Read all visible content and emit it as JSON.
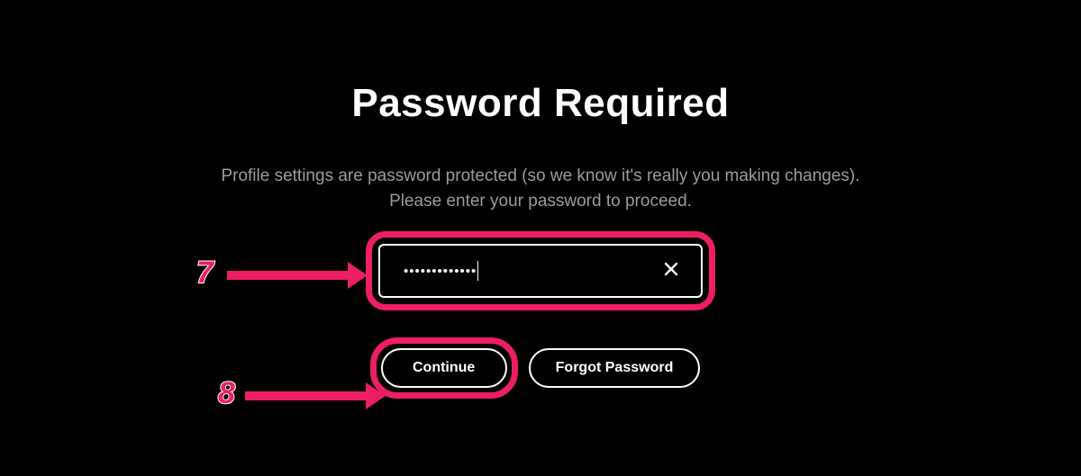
{
  "title": "Password Required",
  "subtitle_line1": "Profile settings are password protected (so we know it's really you making changes).",
  "subtitle_line2": "Please enter your password to proceed.",
  "password": {
    "masked": "•••••••••••••"
  },
  "buttons": {
    "continue": "Continue",
    "forgot": "Forgot Password"
  },
  "annotations": {
    "step7": "7",
    "step8": "8",
    "highlight_color": "#ed1e61"
  }
}
